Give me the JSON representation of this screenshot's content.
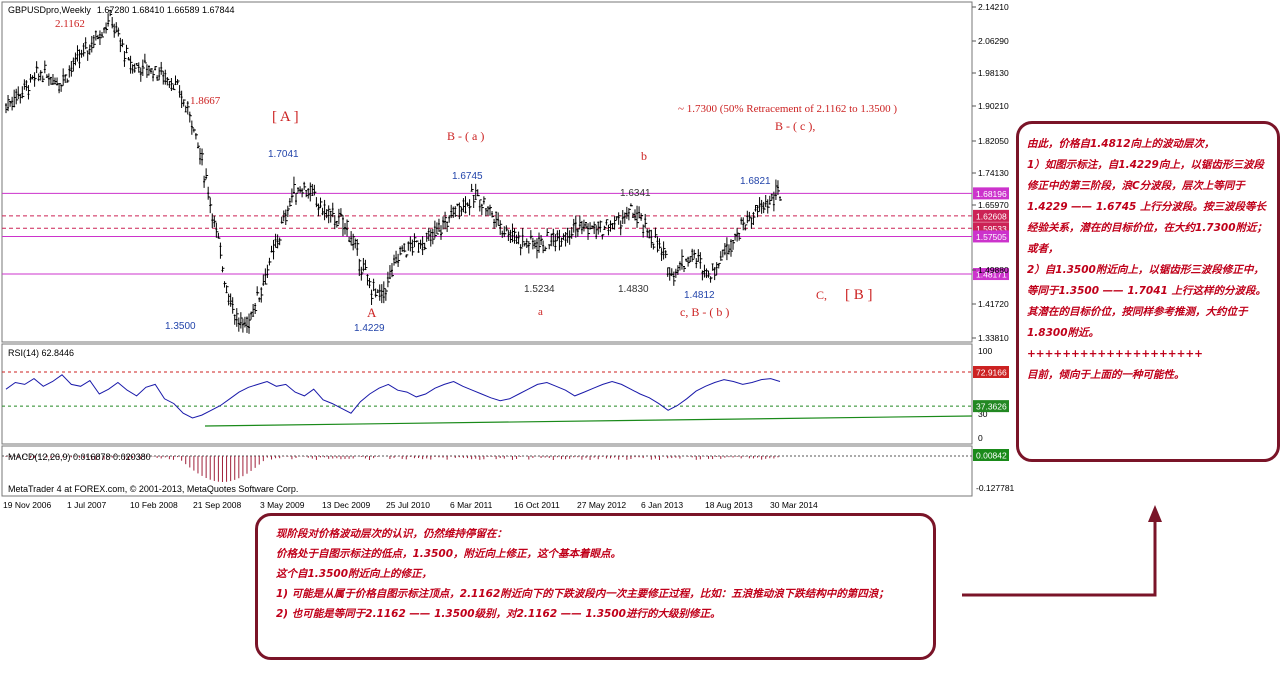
{
  "header": {
    "symbol": "GBPUSDpro,Weekly",
    "ohlc": "1.67280 1.68410 1.66589 1.67844"
  },
  "chart_data": {
    "type": "candlestick",
    "symbol": "GBPUSDpro",
    "timeframe": "Weekly",
    "price_axis_ticks": [
      "2.14210",
      "2.06290",
      "1.98130",
      "1.90210",
      "1.82050",
      "1.74130",
      "1.65970",
      "1.49880",
      "1.41720",
      "1.33810"
    ],
    "price_range": [
      1.318,
      2.152
    ],
    "date_labels": [
      "19 Nov 2006",
      "1 Jul 2007",
      "10 Feb 2008",
      "21 Sep 2008",
      "3 May 2009",
      "13 Dec 2009",
      "25 Jul 2010",
      "6 Mar 2011",
      "16 Oct 2011",
      "27 May 2012",
      "6 Jan 2013",
      "18 Aug 2013",
      "30 Mar 2014"
    ],
    "price_path": [
      {
        "t": 0,
        "p": 1.9
      },
      {
        "t": 0.045,
        "p": 1.98
      },
      {
        "t": 0.07,
        "p": 1.96
      },
      {
        "t": 0.1,
        "p": 2.03
      },
      {
        "t": 0.135,
        "p": 2.116
      },
      {
        "t": 0.16,
        "p": 2.0
      },
      {
        "t": 0.19,
        "p": 1.99
      },
      {
        "t": 0.215,
        "p": 1.96
      },
      {
        "t": 0.24,
        "p": 1.87
      },
      {
        "t": 0.26,
        "p": 1.7
      },
      {
        "t": 0.285,
        "p": 1.45
      },
      {
        "t": 0.3,
        "p": 1.36
      },
      {
        "t": 0.31,
        "p": 1.35
      },
      {
        "t": 0.33,
        "p": 1.45
      },
      {
        "t": 0.35,
        "p": 1.56
      },
      {
        "t": 0.37,
        "p": 1.68
      },
      {
        "t": 0.385,
        "p": 1.7
      },
      {
        "t": 0.41,
        "p": 1.64
      },
      {
        "t": 0.44,
        "p": 1.6
      },
      {
        "t": 0.47,
        "p": 1.45
      },
      {
        "t": 0.485,
        "p": 1.423
      },
      {
        "t": 0.51,
        "p": 1.54
      },
      {
        "t": 0.55,
        "p": 1.57
      },
      {
        "t": 0.585,
        "p": 1.65
      },
      {
        "t": 0.61,
        "p": 1.675
      },
      {
        "t": 0.64,
        "p": 1.6
      },
      {
        "t": 0.67,
        "p": 1.56
      },
      {
        "t": 0.7,
        "p": 1.56
      },
      {
        "t": 0.735,
        "p": 1.6
      },
      {
        "t": 0.77,
        "p": 1.59
      },
      {
        "t": 0.81,
        "p": 1.634
      },
      {
        "t": 0.84,
        "p": 1.56
      },
      {
        "t": 0.86,
        "p": 1.483
      },
      {
        "t": 0.885,
        "p": 1.53
      },
      {
        "t": 0.91,
        "p": 1.481
      },
      {
        "t": 0.935,
        "p": 1.56
      },
      {
        "t": 0.96,
        "p": 1.62
      },
      {
        "t": 0.985,
        "p": 1.66
      },
      {
        "t": 1.0,
        "p": 1.682
      }
    ],
    "horizontal_lines": [
      {
        "price": 1.68196,
        "label": "1.68196",
        "color": "#cc33cc",
        "style": "solid"
      },
      {
        "price": 1.62608,
        "label": "1.62608",
        "color": "#cc2255",
        "style": "dashed"
      },
      {
        "price": 1.59533,
        "label": "1.59533",
        "color": "#cc2255",
        "style": "dashed"
      },
      {
        "price": 1.57505,
        "label": "1.57505",
        "color": "#cc33cc",
        "style": "solid"
      },
      {
        "price": 1.48171,
        "label": "1.48171",
        "color": "#cc33cc",
        "style": "solid"
      }
    ],
    "annotations": [
      {
        "text": "2.1162",
        "color": "#cc2222"
      },
      {
        "text": "1.8667",
        "color": "#cc2222"
      },
      {
        "text": "[ A ]",
        "color": "#cc2222"
      },
      {
        "text": "1.7041",
        "color": "#2244aa"
      },
      {
        "text": "B - ( a )",
        "color": "#cc2222"
      },
      {
        "text": "1.6745",
        "color": "#2244aa"
      },
      {
        "text": "b",
        "color": "#cc2222"
      },
      {
        "text": "1.6341",
        "color": "#333333"
      },
      {
        "text": "~ 1.7300 (50% Retracement of 2.1162 to 1.3500 )",
        "color": "#cc2222"
      },
      {
        "text": "B - ( c ),",
        "color": "#cc2222"
      },
      {
        "text": "1.6821",
        "color": "#2244aa"
      },
      {
        "text": "1.3500",
        "color": "#2244aa"
      },
      {
        "text": "A",
        "color": "#cc2222"
      },
      {
        "text": "1.4229",
        "color": "#2244aa"
      },
      {
        "text": "1.5234",
        "color": "#333333"
      },
      {
        "text": "a",
        "color": "#cc2222"
      },
      {
        "text": "1.4830",
        "color": "#333333"
      },
      {
        "text": "1.4812",
        "color": "#2244aa"
      },
      {
        "text": "c,  B - ( b )",
        "color": "#cc2222"
      },
      {
        "text": "C,",
        "color": "#cc2222"
      },
      {
        "text": "[ B ]",
        "color": "#cc2222"
      }
    ],
    "rsi": {
      "label": "RSI(14) 62.8446",
      "ticks": [
        "100",
        "70",
        "30",
        "0"
      ],
      "levels": [
        {
          "value": 72.9166,
          "label": "72.9166",
          "color": "#cc2222"
        },
        {
          "value": 37.3626,
          "label": "37.3626",
          "color": "#228822"
        }
      ],
      "values": [
        55,
        62,
        60,
        66,
        58,
        63,
        70,
        60,
        58,
        64,
        50,
        55,
        62,
        54,
        48,
        57,
        60,
        45,
        40,
        30,
        25,
        28,
        33,
        38,
        45,
        52,
        57,
        60,
        63,
        58,
        60,
        52,
        48,
        55,
        44,
        40,
        35,
        30,
        42,
        50,
        56,
        60,
        54,
        52,
        47,
        50,
        56,
        60,
        63,
        58,
        54,
        50,
        46,
        43,
        45,
        50,
        55,
        60,
        62,
        58,
        54,
        48,
        52,
        56,
        60,
        63,
        60,
        55,
        50,
        46,
        40,
        33,
        38,
        45,
        53,
        58,
        62,
        65,
        63,
        60,
        62,
        65,
        66,
        63
      ]
    },
    "macd": {
      "label": "MACD(12,26,9) 0.016878 0.020380",
      "value_label": "0.00842",
      "min_label": "-0.127781"
    },
    "footer": "MetaTrader 4 at FOREX.com, © 2001-2013, MetaQuotes Software Corp."
  },
  "notes": {
    "right": [
      "由此，价格自1.4812向上的波动层次，",
      "1）如图示标注，自1.4229向上，以锯齿形三波段修正中的第三阶段，浪C分波段，层次上等同于1.4229 —— 1.6745 上行分波段。按三波段等长经验关系，潜在的目标价位，在大约1.7300附近；或者，",
      "",
      "2）自1.3500附近向上，以锯齿形三波段修正中，等同于1.3500 —— 1.7041 上行这样的分波段。其潜在的目标价位，按同样参考推测，大约位于1.8300附近。",
      "",
      "++++++++++++++++++++",
      "",
      "目前，倾向于上面的一种可能性。"
    ],
    "bottom": [
      "现阶段对价格波动层次的认识，仍然维持停留在：",
      "价格处于自图示标注的低点，1.3500，附近向上修正，这个基本着眼点。",
      "",
      "这个自1.3500附近向上的修正，",
      "1) 可能是从属于价格自图示标注顶点，2.1162附近向下的下跌波段内一次主要修正过程，比如：五浪推动浪下跌结构中的第四浪；",
      "2) 也可能是等同于2.1162 —— 1.3500级别，对2.1162 —— 1.3500进行的大级别修正。"
    ]
  }
}
